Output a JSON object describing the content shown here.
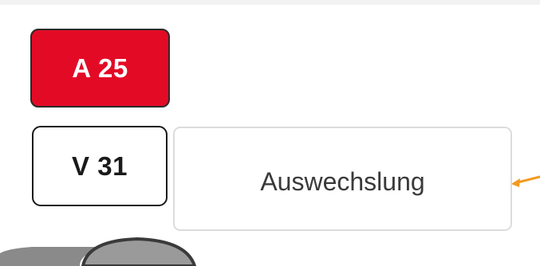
{
  "badges": {
    "red_label": "A 25",
    "white_label": "V 31"
  },
  "substitution": {
    "label": "Auswechslung"
  },
  "colors": {
    "red_badge": "#e30a26",
    "arrow": "#f39a1f"
  },
  "icons": {
    "pointer": "arrow-left-icon",
    "toggle": "toggle-switch-icon"
  }
}
